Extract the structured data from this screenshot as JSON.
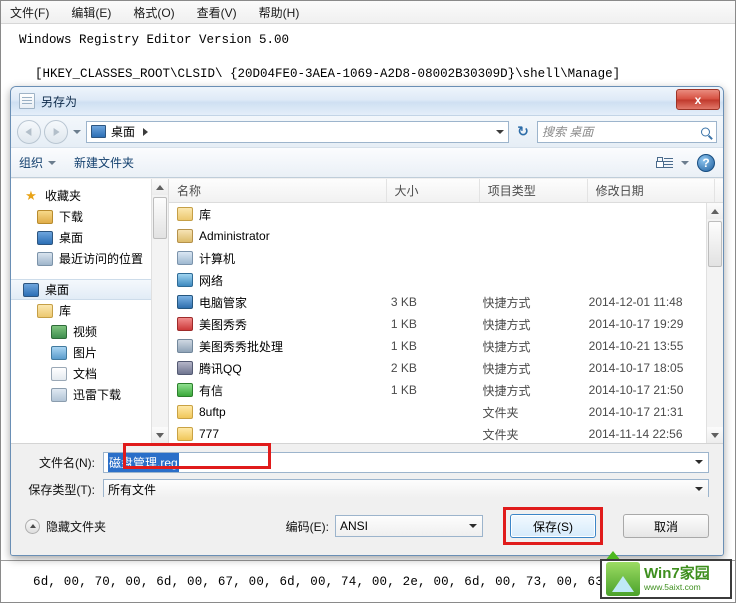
{
  "notepad": {
    "menu": [
      {
        "label": "文件(F)",
        "name": "menu-file"
      },
      {
        "label": "编辑(E)",
        "name": "menu-edit"
      },
      {
        "label": "格式(O)",
        "name": "menu-format"
      },
      {
        "label": "查看(V)",
        "name": "menu-view"
      },
      {
        "label": "帮助(H)",
        "name": "menu-help"
      }
    ],
    "line1": "Windows Registry Editor Version 5.00",
    "line2": "[HKEY_CLASSES_ROOT\\CLSID\\ {20D04FE0-3AEA-1069-A2D8-08002B30309D}\\shell\\Manage]",
    "bottom_line": "6d, 00, 70, 00, 6d, 00, 67, 00, 6d, 00, 74, 00, 2e, 00, 6d, 00, 73, 00, 63, 00, 00, 00"
  },
  "dialog": {
    "title": "另存为",
    "close_label": "x",
    "address": {
      "current": "桌面",
      "refresh_label": "↻"
    },
    "search": {
      "placeholder": "搜索 桌面"
    },
    "toolbar": {
      "organize": "组织",
      "new_folder": "新建文件夹",
      "help_label": "?"
    },
    "sidebar": [
      {
        "label": "收藏夹",
        "icon": "star-icon",
        "level": 0,
        "selected": false
      },
      {
        "label": "下载",
        "icon": "downloads-icon",
        "level": 1,
        "selected": false
      },
      {
        "label": "桌面",
        "icon": "desktop-icon",
        "level": 1,
        "selected": false
      },
      {
        "label": "最近访问的位置",
        "icon": "recent-places-icon",
        "level": 1,
        "selected": false
      },
      {
        "label": "桌面",
        "icon": "desktop-icon",
        "level": 0,
        "selected": true
      },
      {
        "label": "库",
        "icon": "library-icon",
        "level": 1,
        "selected": false
      },
      {
        "label": "视频",
        "icon": "video-icon",
        "level": 2,
        "selected": false
      },
      {
        "label": "图片",
        "icon": "pictures-icon",
        "level": 2,
        "selected": false
      },
      {
        "label": "文档",
        "icon": "documents-icon",
        "level": 2,
        "selected": false
      },
      {
        "label": "迅雷下载",
        "icon": "xunlei-icon",
        "level": 2,
        "selected": false
      }
    ],
    "columns": {
      "name": "名称",
      "size": "大小",
      "type": "项目类型",
      "date": "修改日期"
    },
    "files": [
      {
        "name": "库",
        "size": "",
        "type": "",
        "date": "",
        "icon": "library-icon"
      },
      {
        "name": "Administrator",
        "size": "",
        "type": "",
        "date": "",
        "icon": "user-icon"
      },
      {
        "name": "计算机",
        "size": "",
        "type": "",
        "date": "",
        "icon": "computer-icon"
      },
      {
        "name": "网络",
        "size": "",
        "type": "",
        "date": "",
        "icon": "network-icon"
      },
      {
        "name": "电脑管家",
        "size": "3 KB",
        "type": "快捷方式",
        "date": "2014-12-01 11:48",
        "icon": "app-shortcut-icon"
      },
      {
        "name": "美图秀秀",
        "size": "1 KB",
        "type": "快捷方式",
        "date": "2014-10-17 19:29",
        "icon": "meitu-icon"
      },
      {
        "name": "美图秀秀批处理",
        "size": "1 KB",
        "type": "快捷方式",
        "date": "2014-10-21 13:55",
        "icon": "meitu-batch-icon"
      },
      {
        "name": "腾讯QQ",
        "size": "2 KB",
        "type": "快捷方式",
        "date": "2014-10-17 18:05",
        "icon": "qq-icon"
      },
      {
        "name": "有信",
        "size": "1 KB",
        "type": "快捷方式",
        "date": "2014-10-17 21:50",
        "icon": "youxin-icon"
      },
      {
        "name": "8uftp",
        "size": "",
        "type": "文件夹",
        "date": "2014-10-17 21:31",
        "icon": "folder-icon"
      },
      {
        "name": "777",
        "size": "",
        "type": "文件夹",
        "date": "2014-11-14 22:56",
        "icon": "folder-icon"
      }
    ],
    "form": {
      "filename_label": "文件名(N):",
      "filename_value": "磁盘管理.reg",
      "filetype_label": "保存类型(T):",
      "filetype_value": "所有文件"
    },
    "actions": {
      "hide_folders": "隐藏文件夹",
      "encoding_label": "编码(E):",
      "encoding_value": "ANSI",
      "save": "保存(S)",
      "cancel": "取消"
    }
  },
  "watermark": {
    "title": "Win7家园",
    "url": "www.5aixt.com"
  }
}
